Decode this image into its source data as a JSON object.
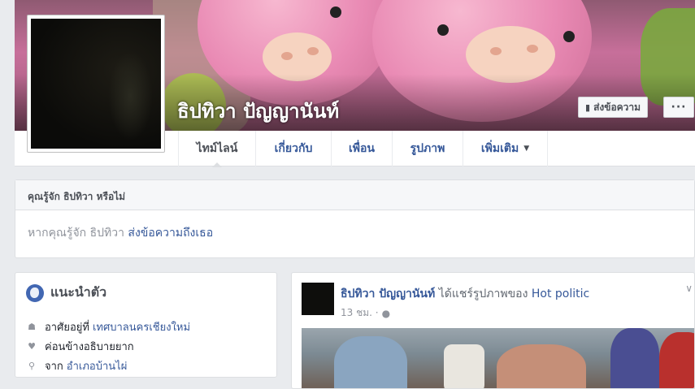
{
  "profile": {
    "name": "ธิปทิวา ปัญญานันท์"
  },
  "actions": {
    "message_label": "ส่งข้อความ",
    "more_label": "···"
  },
  "tabs": [
    {
      "label": "ไทม์ไลน์",
      "active": true
    },
    {
      "label": "เกี่ยวกับ",
      "active": false
    },
    {
      "label": "เพื่อน",
      "active": false
    },
    {
      "label": "รูปภาพ",
      "active": false
    },
    {
      "label": "เพิ่มเติม",
      "active": false
    }
  ],
  "know_box": {
    "heading": "คุณรู้จัก ธิปทิวา หรือไม่",
    "text": "หากคุณรู้จัก ธิปทิวา",
    "link": "ส่งข้อความถึงเธอ"
  },
  "intro": {
    "title": "แนะนำตัว",
    "items": [
      {
        "icon": "home-icon",
        "prefix": "อาศัยอยู่ที่",
        "link": "เทศบาลนครเชียงใหม่"
      },
      {
        "icon": "heart-icon",
        "prefix": "ค่อนข้างอธิบายยาก",
        "link": ""
      },
      {
        "icon": "location-pin-icon",
        "prefix": "จาก",
        "link": "อำเภอบ้านไผ่"
      }
    ]
  },
  "post": {
    "author": "ธิปทิวา ปัญญานันท์",
    "action": "ได้แชร์รูปภาพของ",
    "page": "Hot politic",
    "time": "13 ชม. ·"
  },
  "colors": {
    "link": "#365899",
    "background": "#e9ebee",
    "accent": "#4267b2"
  }
}
